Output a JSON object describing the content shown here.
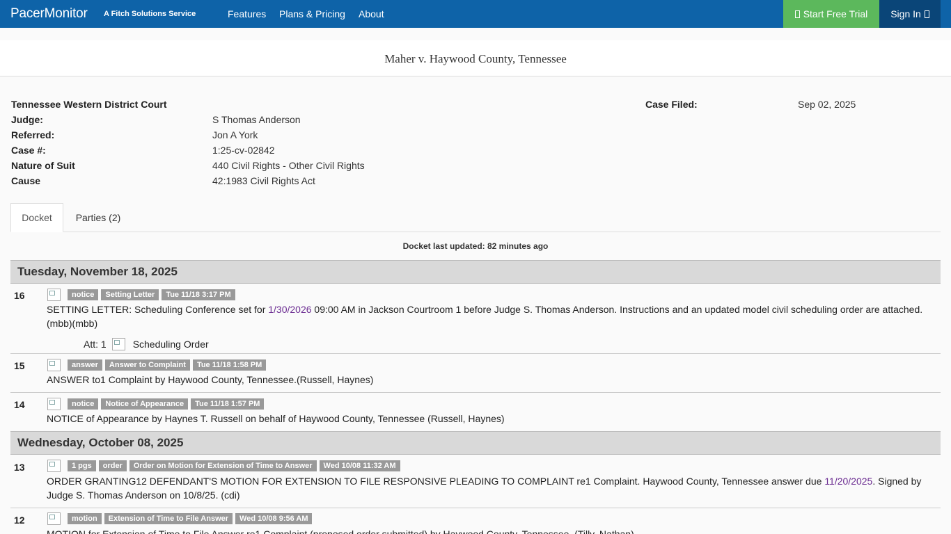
{
  "nav": {
    "brand": "PacerMonitor",
    "brand_sub": "A Fitch Solutions Service",
    "features": "Features",
    "plans": "Plans & Pricing",
    "about": "About",
    "trial": "Start Free Trial",
    "signin": "Sign In"
  },
  "case": {
    "title": "Maher v. Haywood County, Tennessee",
    "court": "Tennessee Western District Court",
    "filed_label": "Case Filed:",
    "filed_value": "Sep 02, 2025",
    "judge_label": "Judge:",
    "judge_value": "S Thomas Anderson",
    "referred_label": "Referred:",
    "referred_value": "Jon A York",
    "caseno_label": "Case #:",
    "caseno_value": "1:25-cv-02842",
    "nos_label": "Nature of Suit",
    "nos_value": "440 Civil Rights - Other Civil Rights",
    "cause_label": "Cause",
    "cause_value": "42:1983 Civil Rights Act"
  },
  "tabs": {
    "docket": "Docket",
    "parties": "Parties (2)"
  },
  "docket": {
    "last_updated": "Docket last updated: 82 minutes ago",
    "date1": "Tuesday, November 18, 2025",
    "date2": "Wednesday, October 08, 2025",
    "e16": {
      "num": "16",
      "tags": [
        "notice",
        "Setting Letter",
        "Tue 11/18 3:17 PM"
      ],
      "text_a": "SETTING LETTER: Scheduling Conference set for ",
      "link": "1/30/2026",
      "text_b": " 09:00 AM in Jackson Courtroom 1 before Judge S. Thomas Anderson. Instructions and an updated model civil scheduling order are attached. (mbb)(mbb)",
      "att_label": "Att: 1",
      "att_name": "Scheduling Order"
    },
    "e15": {
      "num": "15",
      "tags": [
        "answer",
        "Answer to Complaint",
        "Tue 11/18 1:58 PM"
      ],
      "text": "ANSWER to1 Complaint by Haywood County, Tennessee.(Russell, Haynes)"
    },
    "e14": {
      "num": "14",
      "tags": [
        "notice",
        "Notice of Appearance",
        "Tue 11/18 1:57 PM"
      ],
      "text": "NOTICE of Appearance by Haynes T. Russell on behalf of Haywood County, Tennessee (Russell, Haynes)"
    },
    "e13": {
      "num": "13",
      "tags": [
        "1 pgs",
        "order",
        "Order on Motion for Extension of Time to Answer",
        "Wed 10/08 11:32 AM"
      ],
      "text_a": "ORDER GRANTING12 DEFENDANT'S MOTION FOR EXTENSION TO FILE RESPONSIVE PLEADING TO COMPLAINT re1 Complaint. Haywood County, Tennessee answer due ",
      "link": "11/20/2025",
      "text_b": ". Signed by Judge S. Thomas Anderson on 10/8/25. (cdi)"
    },
    "e12": {
      "num": "12",
      "tags": [
        "motion",
        "Extension of Time to File Answer",
        "Wed 10/08 9:56 AM"
      ],
      "text": "MOTION for Extension of Time to File Answer re1 Complaint (proposed order submitted) by Haywood County, Tennessee. (Tilly, Nathan)"
    }
  }
}
